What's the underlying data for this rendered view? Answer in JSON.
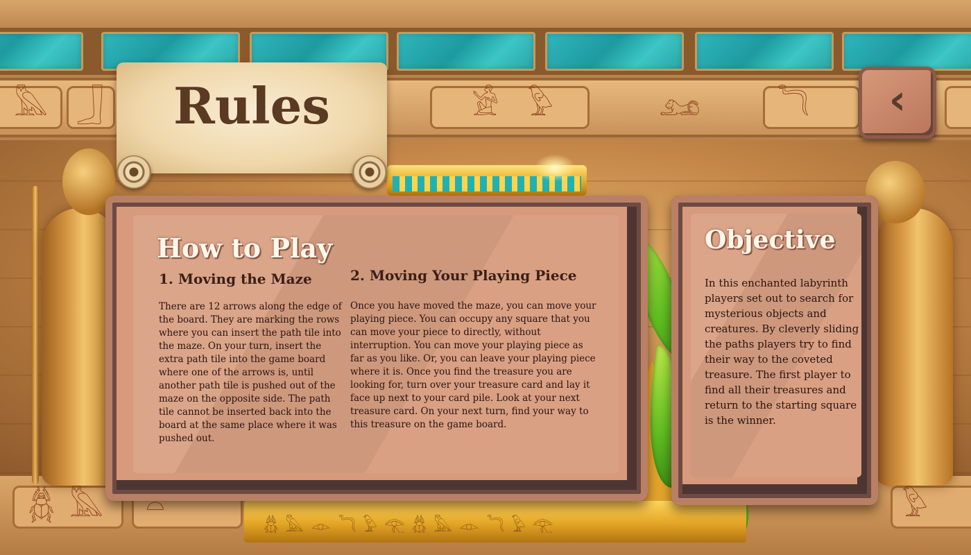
{
  "header": {
    "title": "Rules"
  },
  "navigation": {
    "back_icon": "chevron-left-icon",
    "back_glyph": "‹"
  },
  "how_to_play": {
    "title": "How to Play",
    "sections": [
      {
        "heading": "1. Moving the Maze",
        "text": "There are 12 arrows along the edge of the board. They are marking the rows where you can insert the path tile into the maze. On your turn, insert the extra path tile into the game board where one of the arrows is, until another path tile is pushed out of the maze on the opposite side. The path tile cannot be inserted back into the board at the same place where it was pushed out."
      },
      {
        "heading": "2. Moving Your Playing Piece",
        "text": "Once you have moved the maze, you can move your playing piece. You can occupy any square that you can move your piece to directly, without interruption. You can move your playing piece as far as you like. Or, you can leave your playing piece where it is. Once you find the treasure you are looking for, turn over your treasure card and lay it face up next to your card pile. Look at your next treasure card. On your next turn, find your way to this treasure on the game board."
      }
    ]
  },
  "objective": {
    "title": "Objective",
    "text": "In this enchanted labyrinth players set out to search for mysterious objects and creatures. By cleverly sliding the paths players try to find their way to the coveted treasure. The first player to find all their treasures and return to the starting square is the winner."
  },
  "colors": {
    "stone": "#d79a7d",
    "stone_edge": "#4d3632",
    "heading_text": "#fff7ea",
    "body_text": "#2a1410",
    "turquoise": "#2fb8bd",
    "gold": "#e3a526"
  },
  "decor": {
    "top_glyphs": [
      "𓅓",
      "𓃀",
      "𓀀",
      "𓅱",
      "𓃭",
      "𓆓"
    ],
    "bottom_glyphs": [
      "𓆣",
      "𓅓",
      "𓏏",
      "𓅱"
    ],
    "pedestal_glyphs": "𓆣𓅓𓁹𓆓𓅱𓂀𓆣𓅓𓁹𓆓𓅱𓂀"
  }
}
